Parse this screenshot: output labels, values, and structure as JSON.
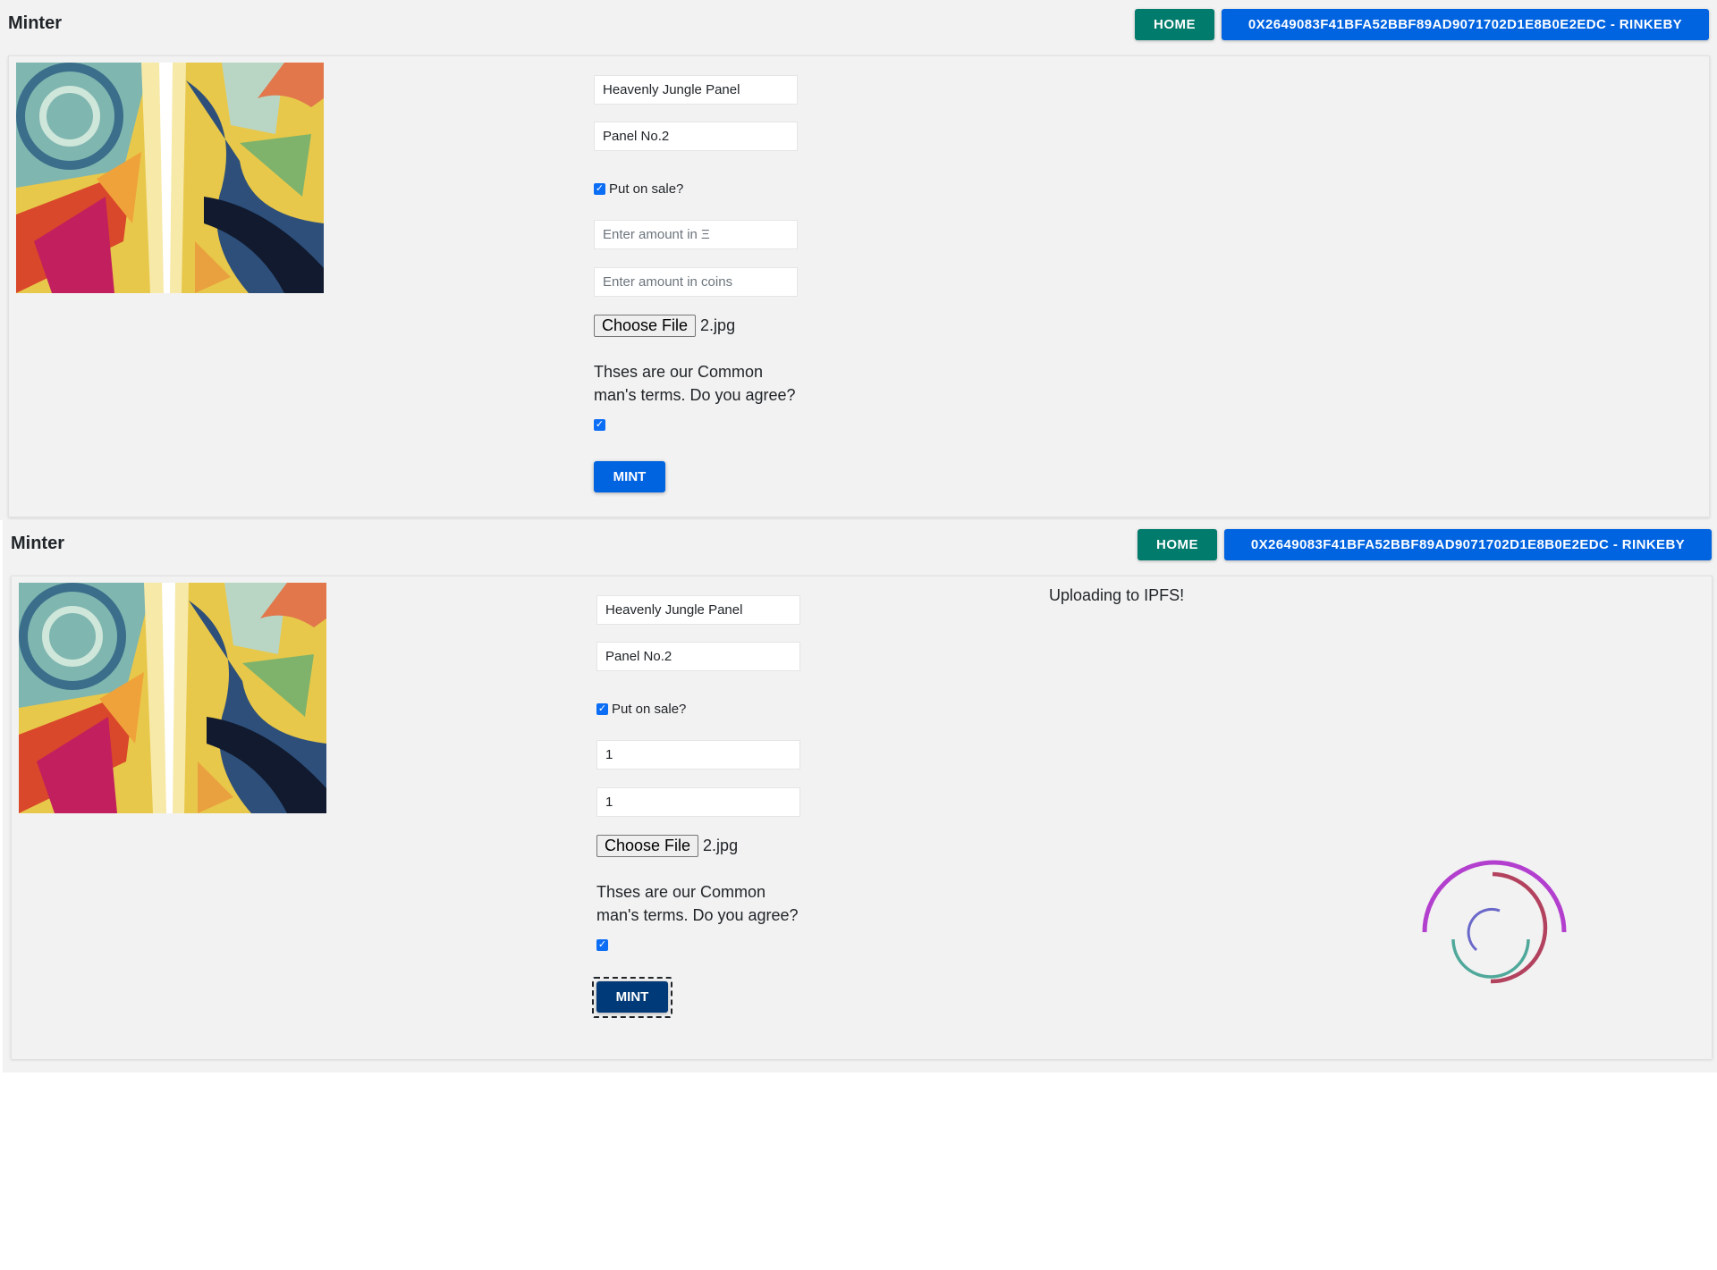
{
  "colors": {
    "home": "#007b6c",
    "primary": "#0063e0",
    "primary_active": "#003a78",
    "background": "#f2f2f2"
  },
  "view1": {
    "brand": "Minter",
    "home_label": "HOME",
    "account_label": "0X2649083F41BFA52BBF89AD9071702D1E8B0E2EDC - RINKEBY",
    "name_value": "Heavenly Jungle Panel",
    "description_value": "Panel No.2",
    "sale_checked": true,
    "sale_label": "Put on sale?",
    "price_eth_placeholder": "Enter amount in Ξ",
    "price_coins_placeholder": "Enter amount in coins",
    "choose_file_label": "Choose File",
    "file_name": "2.jpg",
    "terms_text": "Thses are our Common man's terms. Do you agree?",
    "terms_checked": true,
    "mint_label": "MINT"
  },
  "view2": {
    "brand": "Minter",
    "home_label": "HOME",
    "account_label": "0X2649083F41BFA52BBF89AD9071702D1E8B0E2EDC - RINKEBY",
    "name_value": "Heavenly Jungle Panel",
    "description_value": "Panel No.2",
    "sale_checked": true,
    "sale_label": "Put on sale?",
    "price_eth_value": "1",
    "price_coins_value": "1",
    "choose_file_label": "Choose File",
    "file_name": "2.jpg",
    "terms_text": "Thses are our Common man's terms. Do you agree?",
    "terms_checked": true,
    "mint_label": "MINT",
    "status_text": "Uploading to IPFS!",
    "spinner_icon": "loading-spinner-icon"
  }
}
